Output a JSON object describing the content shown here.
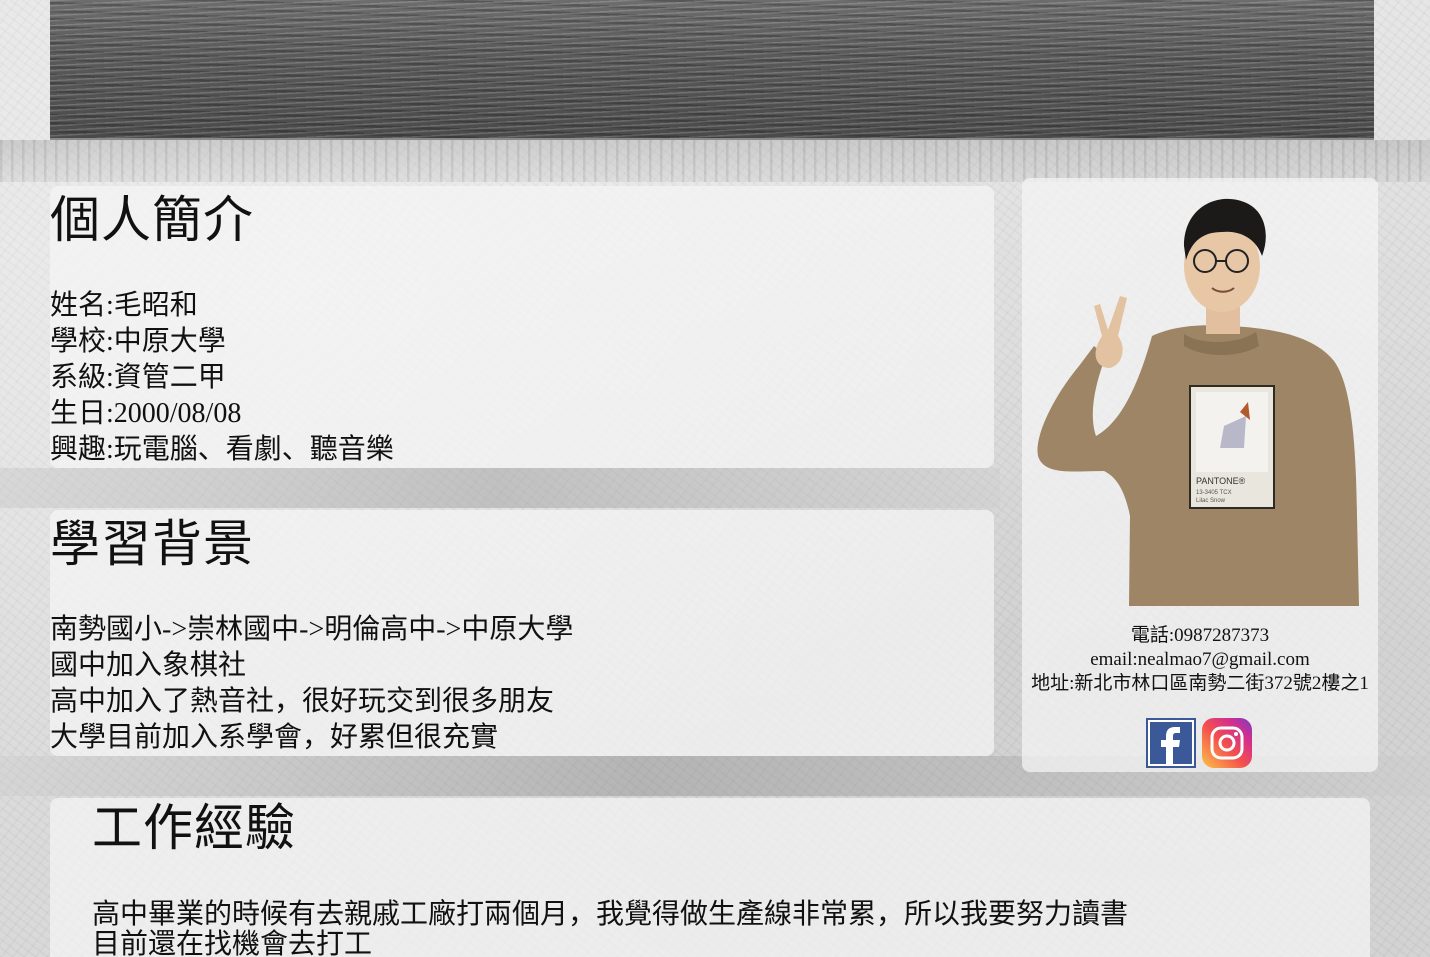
{
  "intro": {
    "heading": "個人簡介",
    "lines": [
      "姓名:毛昭和",
      "學校:中原大學",
      "系級:資管二甲",
      "生日:2000/08/08",
      "興趣:玩電腦、看劇、聽音樂"
    ]
  },
  "education": {
    "heading": "學習背景",
    "lines": [
      "南勢國小->崇林國中->明倫高中->中原大學",
      "國中加入象棋社",
      "高中加入了熱音社，很好玩交到很多朋友",
      "大學目前加入系學會，好累但很充實"
    ]
  },
  "sidebar": {
    "phone": "電話:0987287373",
    "email": "email:nealmao7@gmail.com",
    "address": "地址:新北市林口區南勢二街372號2樓之1",
    "shirt_text": "PANTONE®",
    "shirt_sub1": "13-3405 TCX",
    "shirt_sub2": "Lilac Snow"
  },
  "social": {
    "facebook_icon": "facebook-icon",
    "instagram_icon": "instagram-icon",
    "facebook_color": "#3b5998"
  },
  "work": {
    "heading": "工作經驗",
    "lines": [
      "高中畢業的時候有去親戚工廠打兩個月，我覺得做生產線非常累，所以我要努力讀書",
      "目前還在找機會去打工"
    ]
  }
}
